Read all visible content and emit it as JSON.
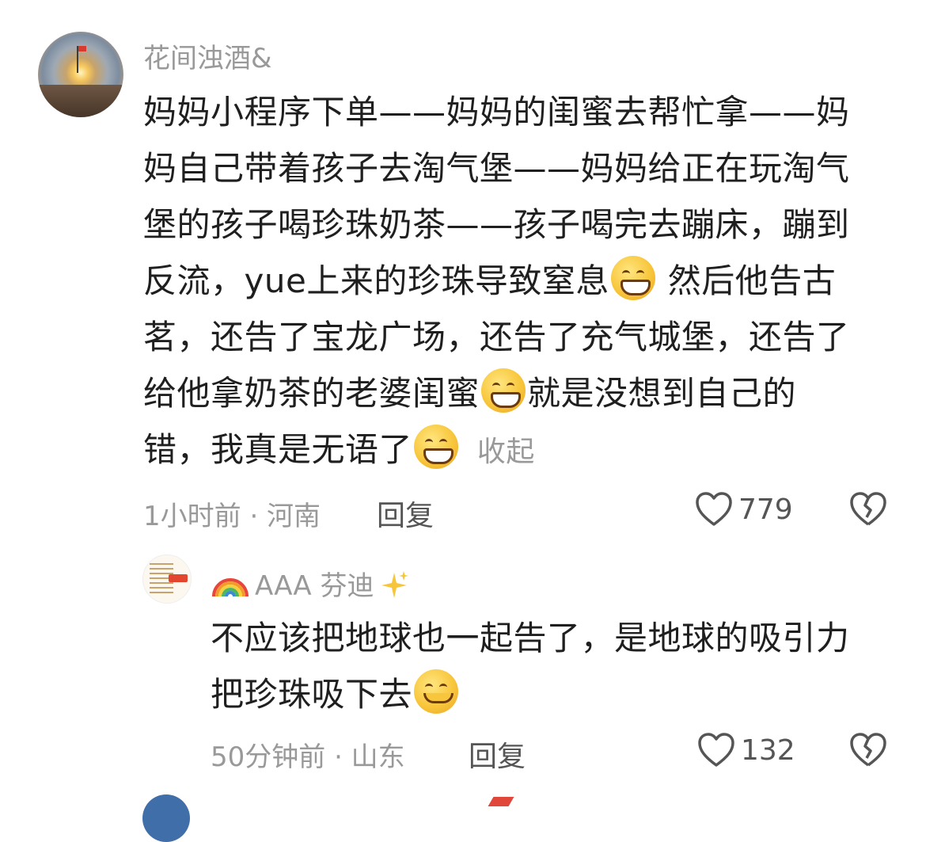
{
  "comment": {
    "username": "花间浊酒&",
    "lines": [
      "妈妈小程序下单——妈妈的闺蜜去帮忙拿——妈",
      "妈自己带着孩子去淘气堡——妈妈给正在玩淘气",
      "堡的孩子喝珍珠奶茶——孩子喝完去蹦床，蹦到",
      "反流，yue上来的珍珠导致窒息",
      "然后他告古",
      "茗，还告了宝龙广场，还告了充气城堡，还告了",
      "给他拿奶茶的老婆闺蜜",
      "就是没想到自己的",
      "错，我真是无语了"
    ],
    "collapse_label": "收起",
    "meta": "1小时前 · 河南",
    "reply_label": "回复",
    "like_count": "779"
  },
  "reply": {
    "username": "AAA 芬迪",
    "lines": [
      "不应该把地球也一起告了，是地球的吸引力",
      "把珍珠吸下去"
    ],
    "meta": "50分钟前 · 山东",
    "reply_label": "回复",
    "like_count": "132"
  },
  "icons": {
    "like": "heart-outline-icon",
    "dislike": "broken-heart-icon",
    "emoji_grin_sweat": "grinning-sweat-emoji",
    "emoji_laugh": "laughing-emoji",
    "emoji_tears": "tears-of-joy-emoji",
    "emoji_smile": "smiling-emoji",
    "rainbow": "rainbow-emoji",
    "sparkles": "sparkles-emoji"
  },
  "colors": {
    "text_primary": "#1f1f1f",
    "text_secondary": "#999999",
    "icon_gray": "#555555"
  }
}
